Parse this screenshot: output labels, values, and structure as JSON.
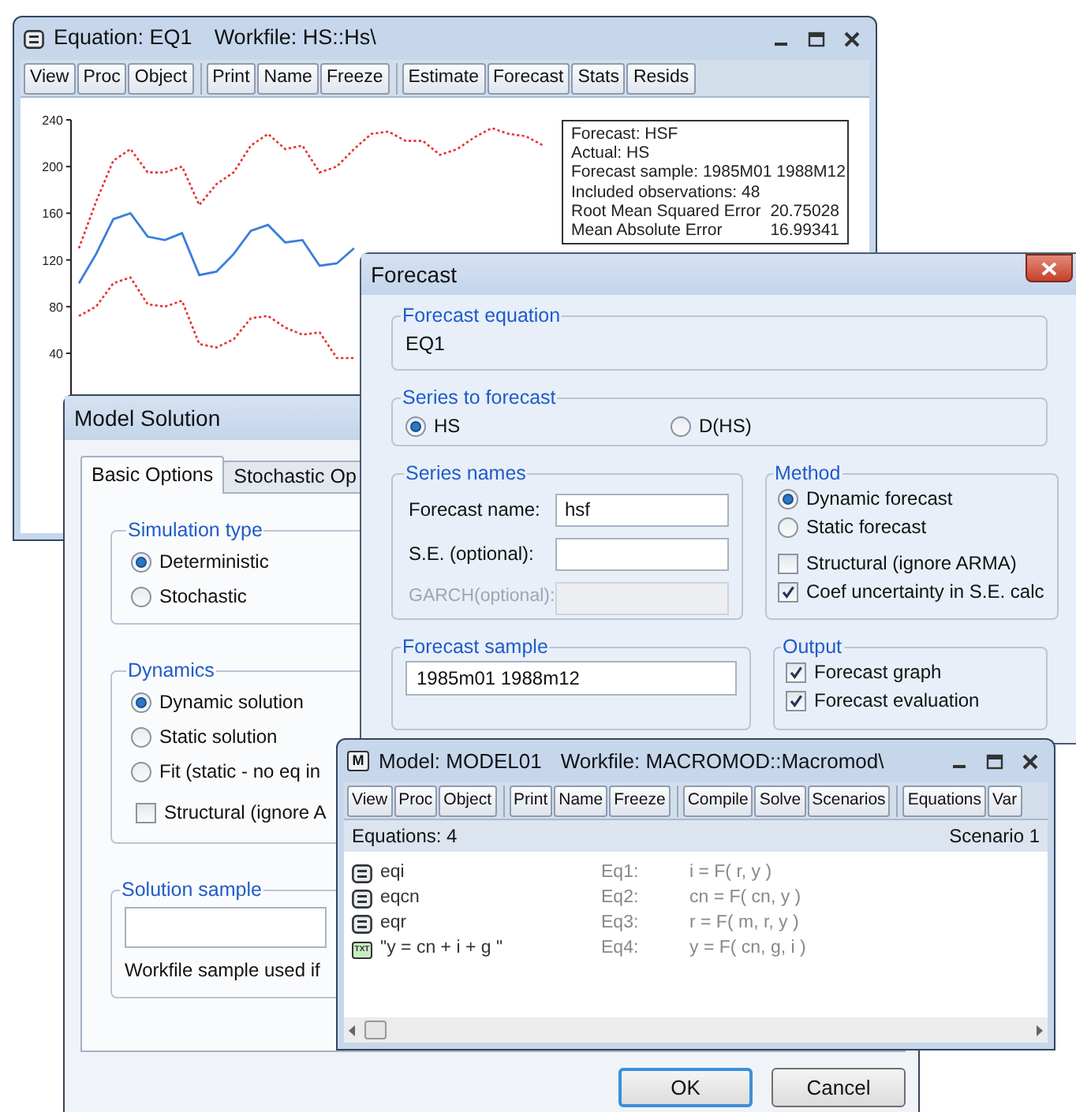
{
  "equation_window": {
    "title": "Equation: EQ1",
    "workfile": "Workfile: HS::Hs\\",
    "toolbar": [
      [
        "View",
        "Proc",
        "Object"
      ],
      [
        "Print",
        "Name",
        "Freeze"
      ],
      [
        "Estimate",
        "Forecast",
        "Stats",
        "Resids"
      ]
    ],
    "chart_data": {
      "type": "line",
      "ylim": [
        0,
        240
      ],
      "yticks": [
        40,
        80,
        120,
        160,
        200,
        240
      ],
      "series": [
        {
          "color": "#e8302a",
          "line_style": "dotted",
          "values": [
            130,
            170,
            205,
            215,
            195,
            195,
            200,
            167,
            185,
            195,
            218,
            228,
            215,
            218,
            195,
            200,
            215,
            228,
            230,
            222,
            222,
            210,
            215,
            225,
            233,
            228,
            226,
            218
          ]
        },
        {
          "color": "#3b7ddd",
          "line_style": "solid",
          "values": [
            100,
            125,
            155,
            160,
            140,
            137,
            143,
            107,
            110,
            125,
            145,
            150,
            135,
            137,
            115,
            117,
            130,
            null,
            null,
            null,
            null,
            null,
            null,
            null,
            null,
            null,
            null,
            null
          ]
        },
        {
          "color": "#e8302a",
          "line_style": "dotted",
          "values": [
            72,
            80,
            100,
            105,
            82,
            80,
            85,
            48,
            45,
            52,
            70,
            72,
            62,
            56,
            58,
            36,
            36,
            null,
            null,
            null,
            null,
            null,
            null,
            null,
            null,
            null,
            null,
            null
          ]
        }
      ]
    },
    "stats": [
      {
        "label": "Forecast: HSF"
      },
      {
        "label": "Actual: HS"
      },
      {
        "label": "Forecast sample: 1985M01 1988M12"
      },
      {
        "label": "Included observations: 48"
      },
      {
        "label": "Root Mean Squared Error",
        "value": "20.75028"
      },
      {
        "label": "Mean Absolute Error",
        "value": "16.99341"
      }
    ]
  },
  "model_solution": {
    "title": "Model Solution",
    "tabs": [
      {
        "label": "Basic Options",
        "selected": true
      },
      {
        "label": "Stochastic Op",
        "selected": false
      }
    ],
    "simulation_type": {
      "title": "Simulation type",
      "options": [
        {
          "label": "Deterministic",
          "selected": true
        },
        {
          "label": "Stochastic",
          "selected": false
        }
      ]
    },
    "dynamics": {
      "title": "Dynamics",
      "options": [
        {
          "label": "Dynamic solution",
          "selected": true
        },
        {
          "label": "Static solution",
          "selected": false
        },
        {
          "label": "Fit (static - no eq in",
          "selected": false
        }
      ],
      "structural": {
        "label": "Structural (ignore A",
        "checked": false
      }
    },
    "solution_sample": {
      "title": "Solution sample",
      "note": "Workfile sample used if"
    },
    "buttons": [
      {
        "label": "OK",
        "default": true
      },
      {
        "label": "Cancel",
        "default": false
      }
    ]
  },
  "forecast_dialog": {
    "title": "Forecast",
    "equation": {
      "title": "Forecast equation",
      "value": "EQ1"
    },
    "series": {
      "title": "Series to forecast",
      "options": [
        {
          "label": "HS",
          "selected": true
        },
        {
          "label": "D(HS)",
          "selected": false
        }
      ]
    },
    "names": {
      "title": "Series names",
      "fields": [
        {
          "label": "Forecast name:",
          "value": "hsf",
          "disabled": false
        },
        {
          "label": "S.E. (optional):",
          "disabled": false
        },
        {
          "label": "GARCH(optional):",
          "disabled": true
        }
      ]
    },
    "method": {
      "title": "Method",
      "options": [
        {
          "label": "Dynamic forecast",
          "selected": true
        },
        {
          "label": "Static forecast",
          "selected": false
        }
      ],
      "checks": [
        {
          "label": "Structural (ignore ARMA)",
          "checked": false
        },
        {
          "label": "Coef uncertainty in S.E. calc",
          "checked": true
        }
      ]
    },
    "sample": {
      "title": "Forecast sample",
      "value": "1985m01 1988m12"
    },
    "output": {
      "title": "Output",
      "checks": [
        {
          "label": "Forecast graph",
          "checked": true
        },
        {
          "label": "Forecast evaluation",
          "checked": true
        }
      ]
    }
  },
  "model_window": {
    "icon_label": "M",
    "title": "Model: MODEL01",
    "workfile": "Workfile: MACROMOD::Macromod\\",
    "toolbar": [
      [
        "View",
        "Proc",
        "Object"
      ],
      [
        "Print",
        "Name",
        "Freeze"
      ],
      [
        "Compile",
        "Solve",
        "Scenarios"
      ],
      [
        "Equations",
        "Var"
      ]
    ],
    "status_left": "Equations: 4",
    "status_right": "Scenario 1",
    "rows": [
      {
        "kind": "equation",
        "name": "eqi",
        "label": "Eq1:",
        "formula": "i = F( r, y )"
      },
      {
        "kind": "equation",
        "name": "eqcn",
        "label": "Eq2:",
        "formula": "cn = F( cn, y )"
      },
      {
        "kind": "equation",
        "name": "eqr",
        "label": "Eq3:",
        "formula": "r = F( m, r, y )"
      },
      {
        "kind": "text",
        "icon_text": "TXT",
        "name": "\"y = cn + i + g \"",
        "label": "Eq4:",
        "formula": "y = F( cn, g, i )"
      }
    ]
  }
}
